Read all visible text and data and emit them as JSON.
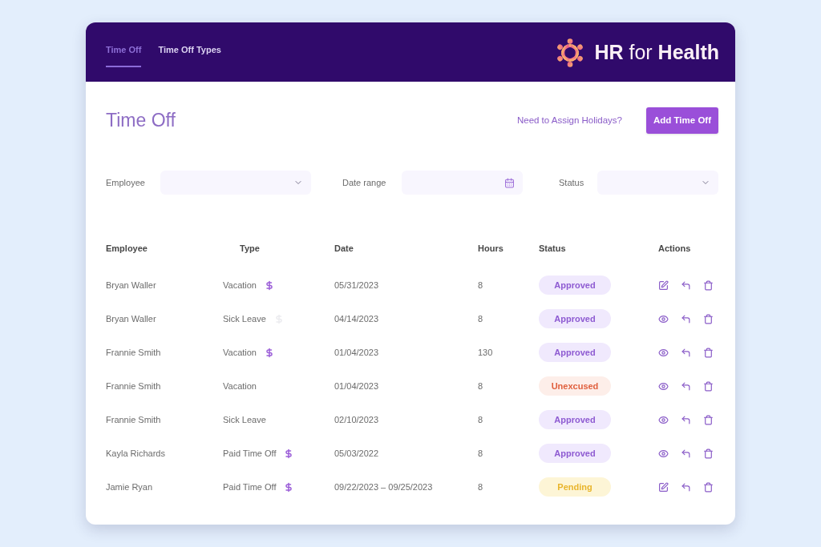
{
  "header": {
    "tabs": [
      {
        "label": "Time Off",
        "selected": true
      },
      {
        "label": "Time Off Types",
        "selected": false
      }
    ],
    "logo_text": "**HR** for **Health**"
  },
  "page": {
    "title": "Time Off",
    "link": "Need to Assign Holidays?",
    "button": "Add Time Off"
  },
  "filters": [
    {
      "label": "Employee",
      "kind": "select"
    },
    {
      "label": "Date range",
      "kind": "date"
    },
    {
      "label": "Status",
      "kind": "select"
    }
  ],
  "table": {
    "columns": [
      "Employee",
      "Type",
      "Date",
      "Hours",
      "Status",
      "Actions"
    ],
    "rows": [
      {
        "employee": "Bryan Waller",
        "type": "Vacation",
        "dollar_icon": true,
        "dimmed": false,
        "date": "05/31/2023",
        "hours": "8",
        "status": {
          "label": "Approved",
          "kind": "approved"
        },
        "actions": [
          {
            "kind": "edit"
          },
          {
            "kind": "return"
          },
          {
            "kind": "delete"
          }
        ]
      },
      {
        "employee": "Bryan Waller",
        "type": "Sick Leave",
        "dollar_icon": true,
        "dimmed": true,
        "date": "04/14/2023",
        "hours": "8",
        "status": {
          "label": "Approved",
          "kind": "approved"
        },
        "actions": [
          {
            "kind": "view"
          },
          {
            "kind": "return"
          },
          {
            "kind": "delete"
          }
        ]
      },
      {
        "employee": "Frannie Smith",
        "type": "Vacation",
        "dollar_icon": true,
        "dimmed": false,
        "date": "01/04/2023",
        "hours": "130",
        "status": {
          "label": "Approved",
          "kind": "approved"
        },
        "actions": [
          {
            "kind": "view"
          },
          {
            "kind": "return"
          },
          {
            "kind": "delete"
          }
        ]
      },
      {
        "employee": "Frannie Smith",
        "type": "Vacation",
        "dollar_icon": false,
        "date": "01/04/2023",
        "hours": "8",
        "status": {
          "label": "Unexcused",
          "kind": "unexcused"
        },
        "actions": [
          {
            "kind": "view"
          },
          {
            "kind": "return"
          },
          {
            "kind": "delete"
          }
        ]
      },
      {
        "employee": "Frannie Smith",
        "type": "Sick Leave",
        "dollar_icon": false,
        "date": "02/10/2023",
        "hours": "8",
        "status": {
          "label": "Approved",
          "kind": "approved"
        },
        "actions": [
          {
            "kind": "view"
          },
          {
            "kind": "return"
          },
          {
            "kind": "delete"
          }
        ]
      },
      {
        "employee": "Kayla Richards",
        "type": "Paid Time Off",
        "dollar_icon": true,
        "dimmed": false,
        "date": "05/03/2022",
        "hours": "8",
        "status": {
          "label": "Approved",
          "kind": "approved"
        },
        "actions": [
          {
            "kind": "view"
          },
          {
            "kind": "return"
          },
          {
            "kind": "delete"
          }
        ]
      },
      {
        "employee": "Jamie Ryan",
        "type": "Paid Time Off",
        "dollar_icon": true,
        "dimmed": false,
        "date": "09/22/2023 – 09/25/2023",
        "hours": "8",
        "status": {
          "label": "Pending",
          "kind": "pending"
        },
        "actions": [
          {
            "kind": "edit"
          },
          {
            "kind": "return"
          },
          {
            "kind": "delete"
          }
        ]
      }
    ]
  }
}
